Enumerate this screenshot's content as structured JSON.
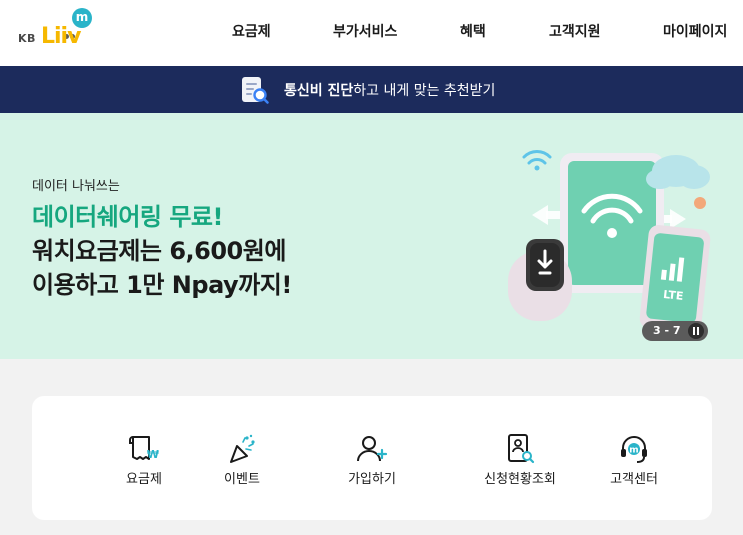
{
  "brand": {
    "kb": "KB",
    "liiv": "Liiv",
    "m": "m"
  },
  "nav": {
    "items": [
      {
        "label": "요금제"
      },
      {
        "label": "부가서비스"
      },
      {
        "label": "혜택"
      },
      {
        "label": "고객지원"
      },
      {
        "label": "마이페이지"
      }
    ]
  },
  "promo_bar": {
    "bold": "통신비 진단",
    "rest": "하고 내게 맞는 추천받기"
  },
  "hero": {
    "kicker": "데이터 나눠쓰는",
    "title": "데이터쉐어링 무료!",
    "line2": "워치요금제는 6,600원에",
    "line3": "이용하고 1만 Npay까지!",
    "device_label": "LTE",
    "pager": "3 - 7"
  },
  "quick_menu": {
    "items": [
      {
        "label": "요금제",
        "icon": "receipt-won-icon"
      },
      {
        "label": "이벤트",
        "icon": "party-popper-icon"
      },
      {
        "label": "가입하기",
        "icon": "user-plus-icon"
      },
      {
        "label": "신청현황조회",
        "icon": "document-search-icon"
      },
      {
        "label": "고객센터",
        "icon": "headset-icon"
      }
    ]
  },
  "colors": {
    "accent_green": "#16a77f",
    "promo_bar_bg": "#1c2b5c",
    "hero_bg": "#d6f3e7",
    "brand_yellow": "#f6b800",
    "brand_teal": "#2ab4c9"
  }
}
